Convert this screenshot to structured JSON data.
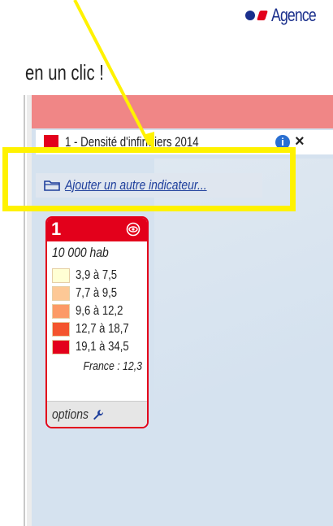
{
  "agency": {
    "text": "Agence",
    "colors": {
      "blue": "#1a2f8c",
      "red": "#e3001b"
    }
  },
  "heading": "en un clic !",
  "indicator": {
    "label": "1 - Densité d'infirmiers  2014",
    "color": "#e3001b",
    "info_icon": "info-icon",
    "close_icon": "close-icon"
  },
  "add_indicator": {
    "label": "Ajouter un autre indicateur...",
    "icon": "folder-icon"
  },
  "legend": {
    "number": "1",
    "eye_icon": "eye-icon",
    "unit": "10 000 hab",
    "classes": [
      {
        "range": "3,9 à 7,5",
        "color": "#ffffd4"
      },
      {
        "range": "7,7 à 9,5",
        "color": "#fdc896"
      },
      {
        "range": "9,6 à 12,2",
        "color": "#fc9a66"
      },
      {
        "range": "12,7 à 18,7",
        "color": "#f4542d"
      },
      {
        "range": "19,1 à 34,5",
        "color": "#e3001b"
      }
    ],
    "france": "France : 12,3",
    "options": "options",
    "options_icon": "wrench-icon"
  },
  "colors": {
    "highlight": "#fff200",
    "title_bar": "#f08686",
    "map": "#d5e2ef"
  }
}
